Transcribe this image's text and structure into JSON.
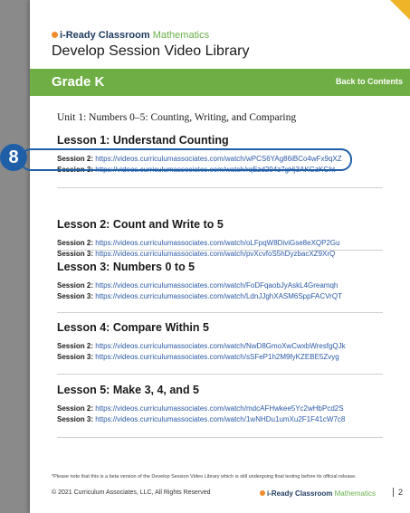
{
  "header": {
    "brand_name": "i-Ready Classroom",
    "brand_suffix": "Mathematics",
    "title": "Develop Session Video Library",
    "grade": "Grade K",
    "back_link": "Back to Contents"
  },
  "unit_title": "Unit 1: Numbers 0–5: Counting, Writing, and Comparing",
  "badge_number": "8",
  "lessons": [
    {
      "title": "Lesson 1: Understand Counting",
      "sessions": [
        {
          "label": "Session 2:",
          "url": "https://videos.curriculumassociates.com/watch/wPCS6YAg86iBCo4wFx9qXZ"
        },
        {
          "label": "Session 3:",
          "url": "https://videos.curriculumassociates.com/watch/rqEzd294z7gHj3AKGzKGht"
        }
      ]
    },
    {
      "title": "Lesson 2: Count and Write to 5",
      "sessions": [
        {
          "label": "Session 2:",
          "url": "https://videos.curriculumassociates.com/watch/oLFpqW8DiviGse8eXQP2Gu"
        },
        {
          "label": "Session 3:",
          "url": "https://videos.curriculumassociates.com/watch/pvXcvfoS5hDyzbacXZ9XrQ"
        }
      ]
    },
    {
      "title": "Lesson 3: Numbers 0 to 5",
      "sessions": [
        {
          "label": "Session 2:",
          "url": "https://videos.curriculumassociates.com/watch/FoDFqaobJyAskL4Greamqh"
        },
        {
          "label": "Session 3:",
          "url": "https://videos.curriculumassociates.com/watch/LdnJJghXASM6SppFACVrQT"
        }
      ]
    },
    {
      "title": "Lesson 4: Compare Within 5",
      "sessions": [
        {
          "label": "Session 2:",
          "url": "https://videos.curriculumassociates.com/watch/NwD8GmoXwCwxbWresfgQJk"
        },
        {
          "label": "Session 3:",
          "url": "https://videos.curriculumassociates.com/watch/sSFeP1h2M9fyKZEBE5Zvyg"
        }
      ]
    },
    {
      "title": "Lesson 5: Make 3, 4, and 5",
      "sessions": [
        {
          "label": "Session 2:",
          "url": "https://videos.curriculumassociates.com/watch/mdcAFHwkee5Yc2wHbPcd2S"
        },
        {
          "label": "Session 3:",
          "url": "https://videos.curriculumassociates.com/watch/1wNHDu1umXu2F1F41cW7c8"
        }
      ]
    }
  ],
  "footer": {
    "note": "*Please note that this is a beta version of the Develop Session Video Library which is still undergoing final testing before its official release.",
    "copyright": "© 2021 Curriculum Associates, LLC, All Rights Reserved",
    "brand_name": "i-Ready Classroom",
    "brand_suffix": "Mathematics",
    "page_number": "2"
  },
  "colors": {
    "band_green": "#6fae45",
    "link_blue": "#2b5aa6",
    "badge_blue": "#1f5fa8"
  }
}
